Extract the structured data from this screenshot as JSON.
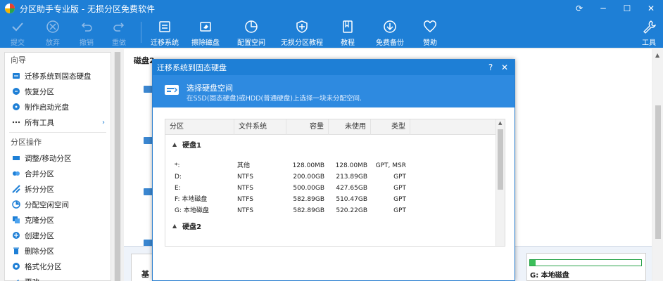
{
  "app": {
    "title": "分区助手专业版 - 无损分区免费软件"
  },
  "toolbar": {
    "commit": "提交",
    "discard": "放弃",
    "undo": "撤销",
    "redo": "重做",
    "migrate": "迁移系统",
    "wipe": "擦除磁盘",
    "allocate": "配置空间",
    "tutorial_lossless": "无损分区教程",
    "tutorial": "教程",
    "backup": "免费备份",
    "donate": "赞助",
    "tools": "工具"
  },
  "sidebar": {
    "wizard_head": "向导",
    "wizard_items": [
      {
        "label": "迁移系统到固态硬盘"
      },
      {
        "label": "恢复分区"
      },
      {
        "label": "制作启动光盘"
      },
      {
        "label": "所有工具"
      }
    ],
    "ops_head": "分区操作",
    "ops_items": [
      {
        "label": "调整/移动分区"
      },
      {
        "label": "合并分区"
      },
      {
        "label": "拆分分区"
      },
      {
        "label": "分配空闲空间"
      },
      {
        "label": "克隆分区"
      },
      {
        "label": "创建分区"
      },
      {
        "label": "删除分区"
      },
      {
        "label": "格式化分区"
      },
      {
        "label": "更改"
      }
    ]
  },
  "main": {
    "disk_label": "磁盘2",
    "bottom_tile_left": "基",
    "bottom_tile_right": "G: 本地磁盘",
    "g_fill_fraction": 0.05
  },
  "dialog": {
    "title": "迁移系统到固态硬盘",
    "help": "?",
    "close": "✕",
    "banner_title": "选择硬盘空间",
    "banner_sub": "在SSD(固态硬盘)或HDD(普通硬盘)上选择一块未分配空间.",
    "columns": {
      "partition": "分区",
      "fs": "文件系统",
      "capacity": "容量",
      "used": "未使用",
      "type": "类型"
    },
    "disk1": "硬盘1",
    "disk2": "硬盘2",
    "rows": [
      {
        "partition": "*:",
        "fs": "其他",
        "capacity": "128.00MB",
        "used": "128.00MB",
        "type": "GPT, MSR"
      },
      {
        "partition": "D:",
        "fs": "NTFS",
        "capacity": "200.00GB",
        "used": "213.89GB",
        "type": "GPT"
      },
      {
        "partition": "E:",
        "fs": "NTFS",
        "capacity": "500.00GB",
        "used": "427.65GB",
        "type": "GPT"
      },
      {
        "partition": "F: 本地磁盘",
        "fs": "NTFS",
        "capacity": "582.89GB",
        "used": "510.47GB",
        "type": "GPT"
      },
      {
        "partition": "G: 本地磁盘",
        "fs": "NTFS",
        "capacity": "582.89GB",
        "used": "520.22GB",
        "type": "GPT"
      }
    ]
  }
}
